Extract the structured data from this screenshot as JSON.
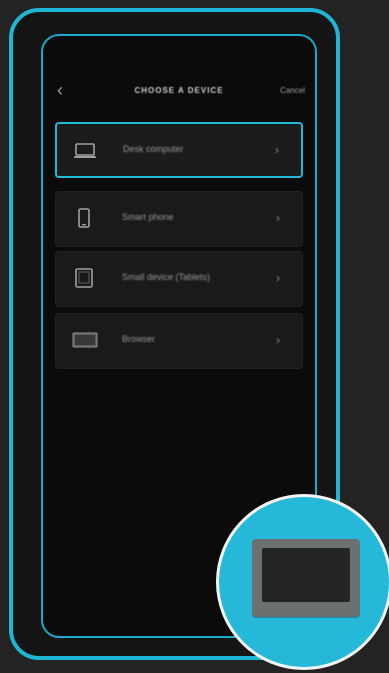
{
  "colors": {
    "accent": "#1fb6d6",
    "background": "#242323",
    "screen": "#0b0b0b",
    "row": "#1a1a1a",
    "text": "#9a9a9a"
  },
  "header": {
    "back_icon": "chevron-left-icon",
    "title": "CHOOSE A DEVICE",
    "cancel_label": "Cancel"
  },
  "devices": [
    {
      "label": "Desk computer",
      "icon": "laptop-icon",
      "selected": true
    },
    {
      "label": "Smart phone",
      "icon": "phone-icon",
      "selected": false
    },
    {
      "label": "Small device (Tablets)",
      "icon": "tablet-icon",
      "selected": false
    },
    {
      "label": "Browser",
      "icon": "monitor-icon",
      "selected": false
    }
  ],
  "magnifier": {
    "icon": "monitor-icon"
  }
}
